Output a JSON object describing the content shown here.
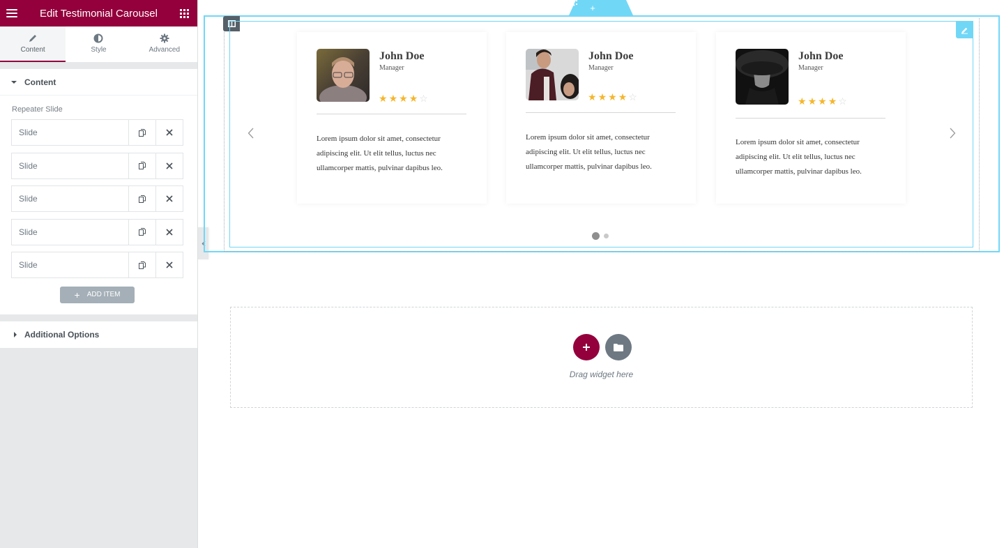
{
  "sidebar": {
    "title": "Edit Testimonial Carousel",
    "tabs": [
      {
        "label": "Content",
        "icon": "pencil-icon",
        "active": true
      },
      {
        "label": "Style",
        "icon": "half-circle-icon",
        "active": false
      },
      {
        "label": "Advanced",
        "icon": "gear-icon",
        "active": false
      }
    ],
    "content_section": {
      "title": "Content",
      "repeater_label": "Repeater Slide",
      "items": [
        {
          "label": "Slide"
        },
        {
          "label": "Slide"
        },
        {
          "label": "Slide"
        },
        {
          "label": "Slide"
        },
        {
          "label": "Slide"
        }
      ],
      "add_item_label": "ADD ITEM"
    },
    "additional_section": {
      "title": "Additional Options"
    }
  },
  "canvas": {
    "section_handle_icons": [
      "plus-icon",
      "drag-icon",
      "close-icon"
    ],
    "carousel": {
      "cards": [
        {
          "name": "John Doe",
          "role": "Manager",
          "rating": 4,
          "max_rating": 5,
          "text": "Lorem ipsum dolor sit amet, consectetur adipiscing elit. Ut elit tellus, luctus nec ullamcorper mattis, pulvinar dapibus leo.",
          "photo": "man-with-glasses"
        },
        {
          "name": "John Doe",
          "role": "Manager",
          "rating": 4,
          "max_rating": 5,
          "text": "Lorem ipsum dolor sit amet, consectetur adipiscing elit. Ut elit tellus, luctus nec ullamcorper mattis, pulvinar dapibus leo.",
          "photo": "smiling-man-plaid-shirt"
        },
        {
          "name": "John Doe",
          "role": "Manager",
          "rating": 4,
          "max_rating": 5,
          "text": "Lorem ipsum dolor sit amet, consectetur adipiscing elit. Ut elit tellus, luctus nec ullamcorper mattis, pulvinar dapibus leo.",
          "photo": "woman-in-black-hat"
        }
      ],
      "pagination": {
        "pages": 2,
        "current": 1
      }
    },
    "drop_zone": {
      "text": "Drag widget here"
    }
  },
  "colors": {
    "brand": "#93003c",
    "selection": "#71d7f7",
    "star": "#f5b62b",
    "star_empty": "#d9d9d9"
  }
}
